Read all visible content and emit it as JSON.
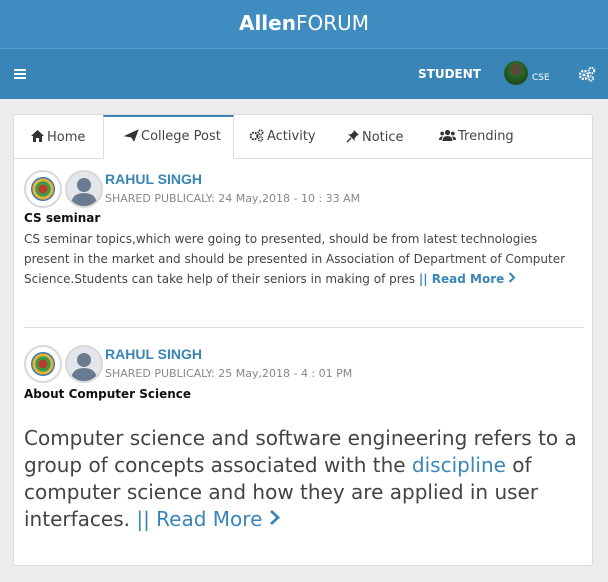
{
  "header": {
    "brand_bold": "Allen",
    "brand_rest": "FORUM"
  },
  "navbar": {
    "role": "STUDENT",
    "department": "CSE"
  },
  "tabs": [
    {
      "label": "Home",
      "icon": "home-icon"
    },
    {
      "label": "College Post",
      "icon": "paper-plane-icon"
    },
    {
      "label": "Activity",
      "icon": "gears-icon"
    },
    {
      "label": "Notice",
      "icon": "pin-icon"
    },
    {
      "label": "Trending",
      "icon": "users-icon"
    }
  ],
  "posts": [
    {
      "author": "RAHUL SINGH",
      "meta": "SHARED PUBLICALY: 24 May,2018 - 10 : 33 AM",
      "title": "CS seminar",
      "body": "CS seminar topics,which were going to presented, should be from latest technologies present in the market and should be presented in Association of Department of Computer Science.Students can take help of their seniors  in making of pres",
      "read_more": "|| Read More"
    },
    {
      "author": "RAHUL SINGH",
      "meta": "SHARED PUBLICALY: 25 May,2018 - 4 : 01 PM",
      "title": "About Computer Science",
      "body_before": "Computer science and software engineering refers to a group of concepts associated with the ",
      "body_link": "discipline",
      "body_after": " of computer science and how they are applied in user interfaces. ",
      "read_more": "|| Read More"
    }
  ],
  "colors": {
    "primary": "#3a85b8",
    "topbar": "#3f8cc0",
    "background": "#ececec"
  }
}
